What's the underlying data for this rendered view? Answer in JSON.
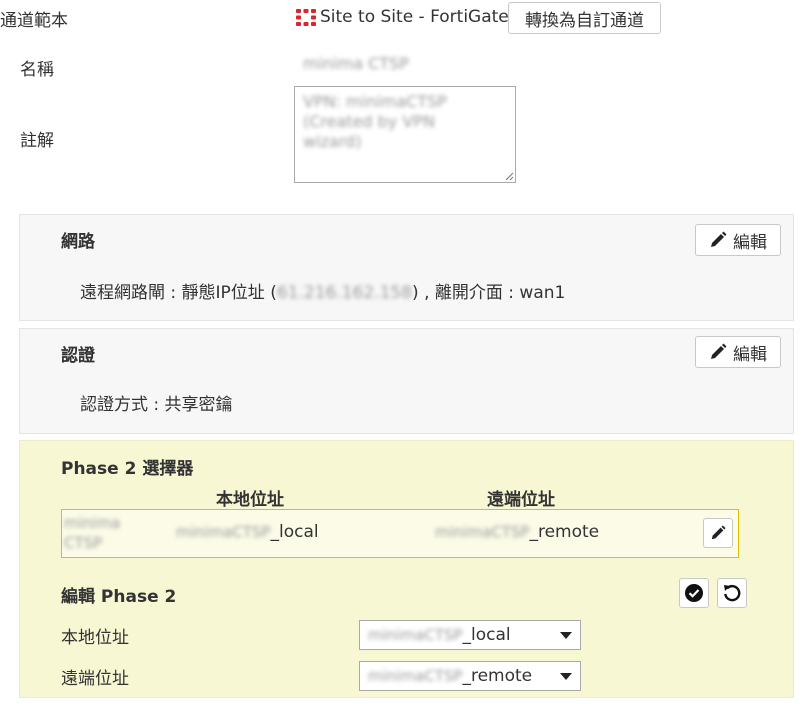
{
  "form": {
    "template_label": "通道範本",
    "template_value": "Site to Site - FortiGate",
    "convert_button": "轉換為自訂通道",
    "name_label": "名稱",
    "name_value": "minima CTSP",
    "comment_label": "註解",
    "comment_lines": [
      "VPN: minimaCTSP",
      "(Created by VPN",
      "wizard)"
    ]
  },
  "network": {
    "title": "網路",
    "edit_label": "編輯",
    "detail_prefix": "遠程網路閘 : 靜態IP位址 (",
    "detail_ip": "61.216.162.158",
    "detail_suffix": ") , 離開介面 : wan1"
  },
  "auth": {
    "title": "認證",
    "edit_label": "編輯",
    "detail": "認證方式 : 共享密鑰"
  },
  "phase2": {
    "selectors_title": "Phase 2 選擇器",
    "col_local": "本地位址",
    "col_remote": "遠端位址",
    "row": {
      "name_line1": "minima",
      "name_line2": "CTSP",
      "local_blur": "minimaCTSP",
      "local_suffix": "_local",
      "remote_blur": "minimaCTSP",
      "remote_suffix": "_remote"
    },
    "edit_title": "編輯 Phase 2",
    "local_label": "本地位址",
    "remote_label": "遠端位址",
    "local_select_blur": "minimaCTSP",
    "local_select_suffix": "_local",
    "remote_select_blur": "minimaCTSP",
    "remote_select_suffix": "_remote"
  },
  "icons": {
    "template": "fortigate-grid-icon",
    "edit": "pencil-icon",
    "confirm": "check-circle-icon",
    "revert": "undo-icon"
  },
  "colors": {
    "template_icon": "#d9262c",
    "phase2_bg": "#f7f7d4",
    "selected_border": "#e0c000"
  }
}
